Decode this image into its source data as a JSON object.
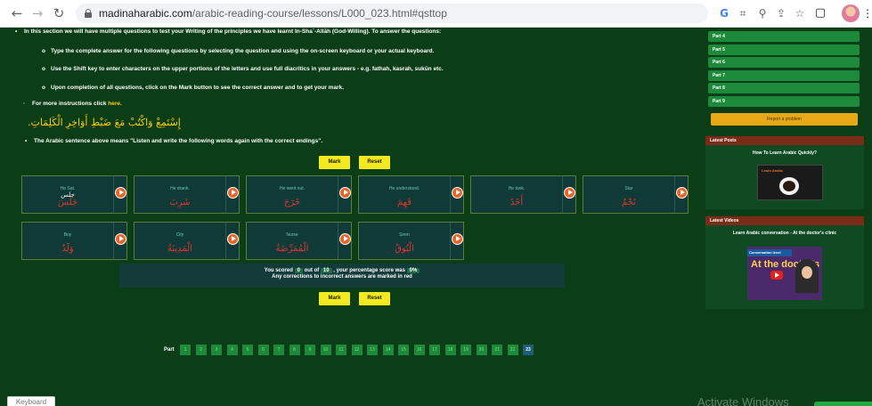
{
  "browser": {
    "url_host": "madinaharabic.com",
    "url_path": "/arabic-reading-course/lessons/L000_023.html#qsttop",
    "icons": [
      "back-arrow-icon",
      "forward-arrow-icon",
      "reload-icon",
      "lock-icon",
      "google-icon",
      "translate-icon",
      "zoom-icon",
      "share-icon",
      "star-icon",
      "tab-icon",
      "profile-avatar"
    ]
  },
  "instructions": {
    "intro": "In this section we will have multiple questions to test your Writing of the principles we have learnt In-Sha`-Allāh (God-Willing).  To answer the questions:",
    "step1": "Type the complete answer for the following questions by selecting the question and using the on-screen keyboard or your actual keyboard.",
    "step2": "Use the Shift key to enter characters on the upper portions of the letters and use full diacritics in your answers - e.g. fathah, kasrah, sukūn etc.",
    "step3": "Upon completion of all questions, click on the Mark button to see the correct answer and to get your mark.",
    "more_prefix": "For more instructions click ",
    "more_link": "here."
  },
  "arabic_sentence": "إِسْتَمِعْ وَاكْتُبْ مَعَ ضَبْطِ أَوَاخِرِ الْكَلِمَاتِ.",
  "meaning": "The Arabic sentence above means \"Listen and write the following words again with the correct endings\".",
  "buttons": {
    "mark": "Mark",
    "reset": "Reset"
  },
  "questions": [
    {
      "en": "He Sat.",
      "answer": "جلس",
      "arabic": "جَلَسَ"
    },
    {
      "en": "He drank.",
      "answer": "",
      "arabic": "شَرِبَ"
    },
    {
      "en": "He went out.",
      "answer": "",
      "arabic": "خَرَجَ"
    },
    {
      "en": "He understood.",
      "answer": "",
      "arabic": "فَهِمَ"
    },
    {
      "en": "He took.",
      "answer": "",
      "arabic": "أَخَذَ"
    },
    {
      "en": "Star",
      "answer": "",
      "arabic": "نَجْمٌ"
    },
    {
      "en": "Boy",
      "answer": "",
      "arabic": "وَلَدٌ"
    },
    {
      "en": "City",
      "answer": "",
      "arabic": "الْمَدِينَةُ"
    },
    {
      "en": "Nurse",
      "answer": "",
      "arabic": "الْمُمَرِّضَةُ"
    },
    {
      "en": "Siren",
      "answer": "",
      "arabic": "الْبُوقُ"
    }
  ],
  "score": {
    "prefix": "You scored",
    "scored": "0",
    "middle": "out of",
    "total": "10",
    "pct_prefix": ", your percentage score was",
    "percent": "0%",
    "note": "Any corrections to incorrect answers are marked in red"
  },
  "pagination": {
    "label": "Part",
    "pages": [
      "1",
      "2",
      "3",
      "4",
      "5",
      "6",
      "7",
      "8",
      "9",
      "10",
      "11",
      "12",
      "13",
      "14",
      "15",
      "16",
      "17",
      "18",
      "19",
      "20",
      "21",
      "22",
      "23"
    ],
    "active": "23"
  },
  "keyboard_tab": "Keyboard",
  "sidebar": {
    "parts": [
      "Part 4",
      "Part 5",
      "Part 6",
      "Part 7",
      "Part 8",
      "Part 9"
    ],
    "report": "Report a problem",
    "latest_posts_head": "Latest Posts",
    "post_title": "How To Learn Arabic Quickly?",
    "post_thumb_text": "Learn Arabic",
    "latest_videos_head": "Latest Videos",
    "video_title": "Learn Arabic conversation - At the doctor's clinic",
    "video_bar": "Conversation level",
    "video_big": "At the doctor's"
  },
  "watermark": "Activate Windows",
  "colors": {
    "page_bg": "#0b3d17",
    "accent_yellow": "#f2ea1e",
    "answer_red": "#e63232",
    "part_green": "#1c8a3a",
    "report_orange": "#e8a917",
    "head_brown": "#7b2c18"
  }
}
